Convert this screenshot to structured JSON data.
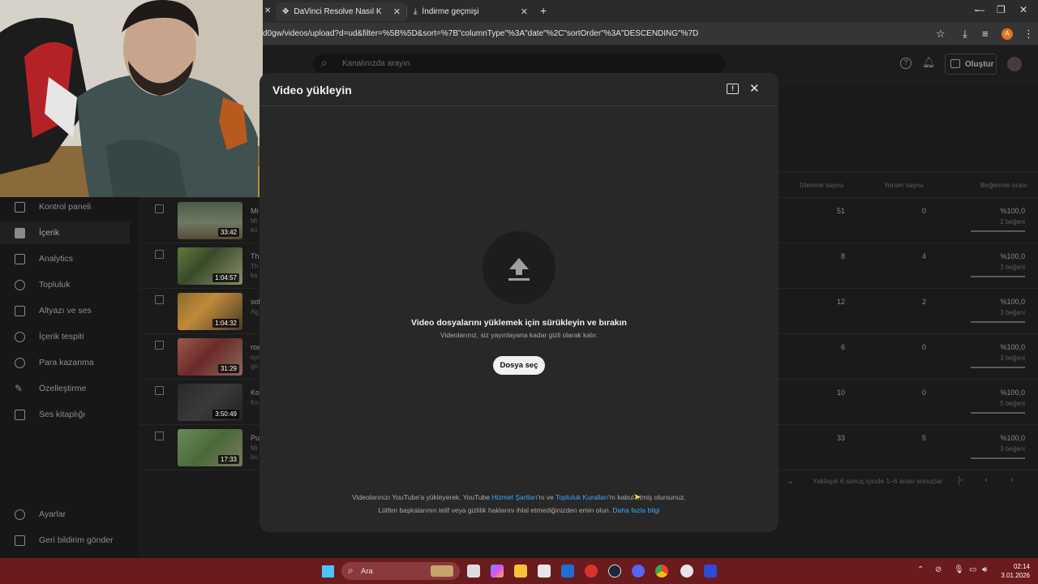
{
  "browser": {
    "tabs": [
      {
        "label": "DaVinci Resolve Nasıl Kullanılır",
        "icon": "davinci-icon"
      },
      {
        "label": "İndirme geçmişi",
        "icon": "download-icon"
      }
    ],
    "new_tab": "+",
    "url": "d0gw/videos/upload?d=ud&filter=%5B%5D&sort=%7B\"columnType\"%3A\"date\"%2C\"sortOrder\"%3A\"DESCENDING\"%7D",
    "profile_initial": "A"
  },
  "studio": {
    "search_placeholder": "Kanalınızda arayın",
    "create_label": "Oluştur",
    "sidebar": [
      {
        "label": "Kontrol paneli",
        "icon": "dashboard-icon"
      },
      {
        "label": "İçerik",
        "icon": "content-icon",
        "active": true
      },
      {
        "label": "Analytics",
        "icon": "analytics-icon"
      },
      {
        "label": "Topluluk",
        "icon": "community-icon"
      },
      {
        "label": "Altyazı ve ses",
        "icon": "subtitles-icon"
      },
      {
        "label": "İçerik tespiti",
        "icon": "copyright-icon"
      },
      {
        "label": "Para kazanma",
        "icon": "monetization-icon"
      },
      {
        "label": "Özelleştirme",
        "icon": "customization-icon"
      },
      {
        "label": "Ses kitaplığı",
        "icon": "audio-library-icon"
      }
    ],
    "settings_label": "Ayarlar",
    "feedback_label": "Geri bildirim gönder",
    "columns": {
      "views": "İzlenme sayısı",
      "comments": "Yorum sayısı",
      "likes": "Beğenme oranı"
    },
    "rows": [
      {
        "title": "Mi",
        "sub1": "Mi",
        "sub2": "ko",
        "duration": "33:42",
        "views": "51",
        "comments": "0",
        "likes": "%100,0",
        "likes_sub": "2 beğeni"
      },
      {
        "title": "Th",
        "sub1": "Th",
        "sub2": "ka",
        "duration": "1:04:57",
        "views": "8",
        "comments": "4",
        "likes": "%100,0",
        "likes_sub": "3 beğeni"
      },
      {
        "title": "sol",
        "sub1": "Ag",
        "sub2": "",
        "duration": "1:04:32",
        "views": "12",
        "comments": "2",
        "likes": "%100,0",
        "likes_sub": "3 beğeni"
      },
      {
        "title": "roa",
        "sub1": "oyı",
        "sub2": "gü",
        "duration": "31:29",
        "views": "6",
        "comments": "0",
        "likes": "%100,0",
        "likes_sub": "3 beğeni"
      },
      {
        "title": "Ko",
        "sub1": "Ko",
        "sub2": "",
        "duration": "3:50:49",
        "views": "10",
        "comments": "0",
        "likes": "%100,0",
        "likes_sub": "5 beğeni"
      },
      {
        "title": "Pu",
        "sub1": "Mi",
        "sub2": "bu",
        "duration": "17:33",
        "views": "33",
        "comments": "5",
        "likes": "%100,0",
        "likes_sub": "3 beğeni"
      }
    ],
    "pagination_text": "Yaklaşık 6 sonuç içinde 1–6 arası sonuçlar"
  },
  "modal": {
    "title": "Video yükleyin",
    "drag_title": "Video dosyalarını yüklemek için sürükleyin ve bırakın",
    "drag_sub": "Videolarınız, siz yayınlayana kadar gizli olarak kalır.",
    "select_button": "Dosya seç",
    "terms_prefix": "Videolarınızı YouTube'a yükleyerek, YouTube ",
    "terms_link1": "Hizmet Şartları",
    "terms_mid": "'nı ve ",
    "terms_link2": "Topluluk Kuralları",
    "terms_suffix": "'nı kabul etmiş olursunuz.",
    "rights_text": "Lütfen başkalarının telif veya gizlilik haklarını ihlal etmediğinizden emin olun. ",
    "learn_more": "Daha fazla bilgi"
  },
  "taskbar": {
    "search_label": "Ara",
    "time": "02:14",
    "date": "3.01.2026"
  },
  "colors": {
    "accent_link": "#3ea6ff",
    "taskbar": "#6b1a1e",
    "modal": "#282828"
  }
}
